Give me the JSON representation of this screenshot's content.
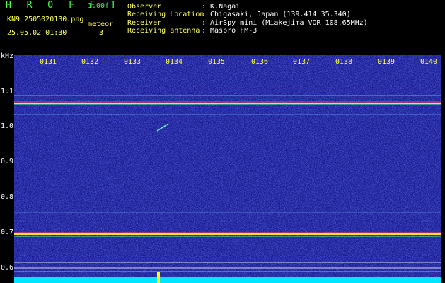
{
  "header": {
    "app_title": "H R O F F T",
    "version": "1.00f",
    "filename": "KN9_2505020130.png",
    "datetime": "25.05.02 01:30",
    "meteor_label": "meteor",
    "meteor_count": "3"
  },
  "info": [
    {
      "label": "Observer",
      "value": ": K.Nagai"
    },
    {
      "label": "Receiving Location",
      "value": ": Chigasaki, Japan (139.414 35.340)"
    },
    {
      "label": "Receiver",
      "value": ": AirSpy mini (Miakejima VOR 108.65MHz)"
    },
    {
      "label": "Receiving antenna",
      "value": ": Maspro FM-3"
    }
  ],
  "axis": {
    "unit": "kHz",
    "y_ticks": [
      "1.1",
      "1.0",
      "0.9",
      "0.8",
      "0.7",
      "0.6"
    ],
    "x_ticks": [
      "0131",
      "0132",
      "0133",
      "0134",
      "0135",
      "0136",
      "0137",
      "0138",
      "0139",
      "0140"
    ]
  },
  "colors": {
    "background": "#000000",
    "waterfall_base": "#1a1a8c",
    "carrier_line": "#ffdd33",
    "baseline_trace": "#00e5ff",
    "header_green": "#44ff44",
    "header_yellow": "#ffff55"
  }
}
